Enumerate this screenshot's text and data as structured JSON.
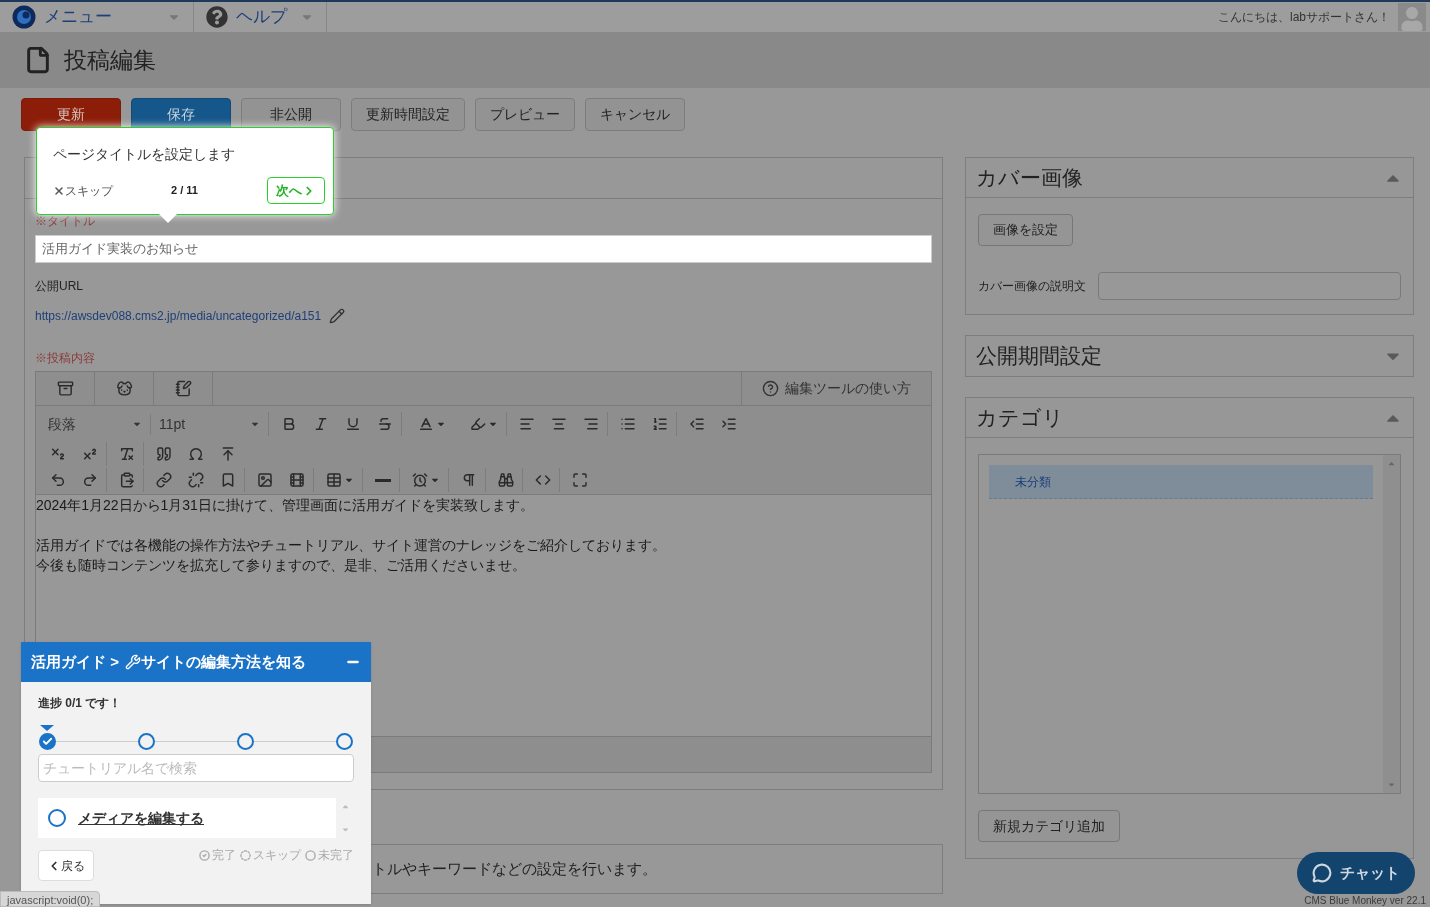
{
  "topbar": {
    "menu": "メニュー",
    "help": "ヘルプ",
    "greeting": "こんにちは、labサポートさん！"
  },
  "page_title": "投稿編集",
  "actions": [
    {
      "label": "更新",
      "kind": "danger"
    },
    {
      "label": "保存",
      "kind": "primary"
    },
    {
      "label": "非公開",
      "kind": "default"
    },
    {
      "label": "更新時間設定",
      "kind": "default"
    },
    {
      "label": "プレビュー",
      "kind": "default"
    },
    {
      "label": "キャンセル",
      "kind": "default"
    }
  ],
  "editor_form": {
    "title_label": "※タイトル",
    "title_value": "活用ガイド実装のお知らせ",
    "url_label": "公開URL",
    "url": "https://awsdev088.cms2.jp/media/uncategorized/a151",
    "content_label": "※投稿内容",
    "help": "編集ツールの使い方",
    "block_format": "段落",
    "font_size": "11pt",
    "paragraphs": [
      [
        "2024年1月22日から1月31日に掛けて、管理画面に活用ガイドを実装致します。"
      ],
      [
        "活用ガイドでは各機能の操作方法やチュートリアル、サイト運営のナレッジをご紹介しております。",
        "今後も随時コンテンツを拡充して参りますので、是非、ご活用くださいませ。"
      ]
    ]
  },
  "seo_section": {
    "description_fragment": "トルやキーワードなどの設定を行います。"
  },
  "sidebar": {
    "panels": [
      {
        "kind": "cover",
        "title": "カバー画像",
        "expanded": true,
        "button": "画像を設定",
        "caption_label": "カバー画像の説明文"
      },
      {
        "kind": "period",
        "title": "公開期間設定",
        "expanded": false
      },
      {
        "kind": "category",
        "title": "カテゴリ",
        "expanded": true,
        "items": [
          {
            "label": "未分類",
            "selected": true
          }
        ],
        "button": "新規カテゴリ追加"
      }
    ]
  },
  "tour_tooltip": {
    "message": "ページタイトルを設定します",
    "skip": "スキップ",
    "step": "2 / 11",
    "next": "次へ"
  },
  "guide": {
    "breadcrumb": "活用ガイド >",
    "title": "サイトの編集方法を知る",
    "progress": "進捗 0/1 です！",
    "steps": [
      {
        "done": true,
        "current": true
      },
      {
        "done": false,
        "current": false
      },
      {
        "done": false,
        "current": false
      },
      {
        "done": false,
        "current": false
      }
    ],
    "search_placeholder": "チュートリアル名で検索",
    "tutorials": [
      {
        "label": "メディアを編集する",
        "done": false
      }
    ],
    "back": "戻る",
    "legend": [
      "完了",
      "スキップ",
      "未完了"
    ]
  },
  "chat_button": "チャット",
  "footer": "CMS Blue Monkey ver 22.1",
  "status_url": "javascript:void(0);"
}
